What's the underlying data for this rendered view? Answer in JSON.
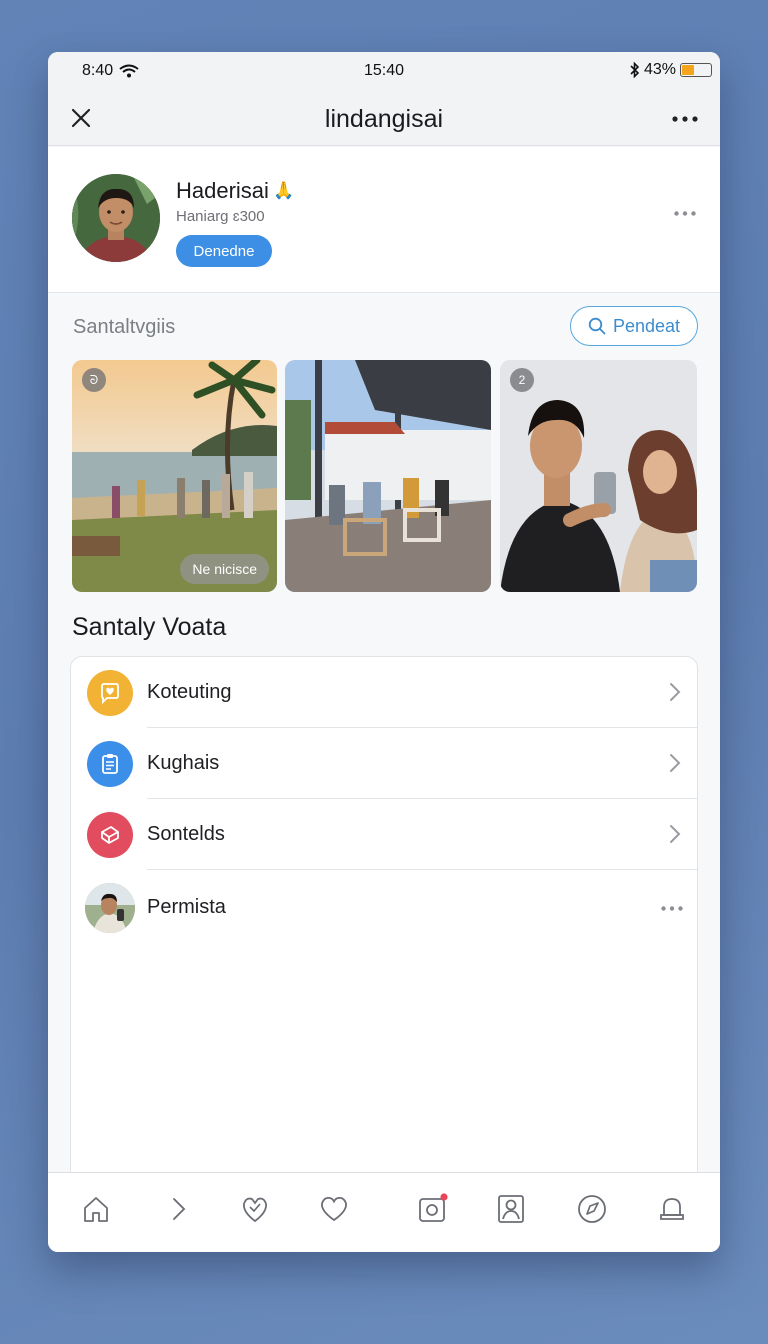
{
  "status_bar": {
    "time_left": "8:40",
    "time_center": "15:40",
    "battery_percent": "43%",
    "battery_level": 0.43
  },
  "nav": {
    "title": "lindangisai",
    "close_icon": "close-icon",
    "more_icon": "more-icon"
  },
  "profile": {
    "name": "Haderisai",
    "emoji": "🙏",
    "subtitle": "Haniarg ɛ300",
    "button_label": "Denedne"
  },
  "gallery": {
    "section_label": "Santaltvgiis",
    "search_label": "Pendeat",
    "photos": [
      {
        "badge": "ᘐ",
        "chip": "Ne nicisce"
      },
      {},
      {
        "badge": "2"
      }
    ]
  },
  "list": {
    "title": "Santaly Voata",
    "items": [
      {
        "label": "Koteuting",
        "icon": "heart-chat-icon",
        "color": "#f2b233"
      },
      {
        "label": "Kughais",
        "icon": "document-icon",
        "color": "#3b8fe8"
      },
      {
        "label": "Sontelds",
        "icon": "box-icon",
        "color": "#e24c5f"
      },
      {
        "label": "Permista",
        "icon": "avatar"
      }
    ]
  },
  "tab_bar": {
    "icons": [
      "home-icon",
      "chevron-right-icon",
      "heart-hand-icon",
      "heart-icon",
      "camera-icon",
      "contacts-icon",
      "compass-icon",
      "bell-icon"
    ],
    "notification_color": "#e8475a"
  }
}
